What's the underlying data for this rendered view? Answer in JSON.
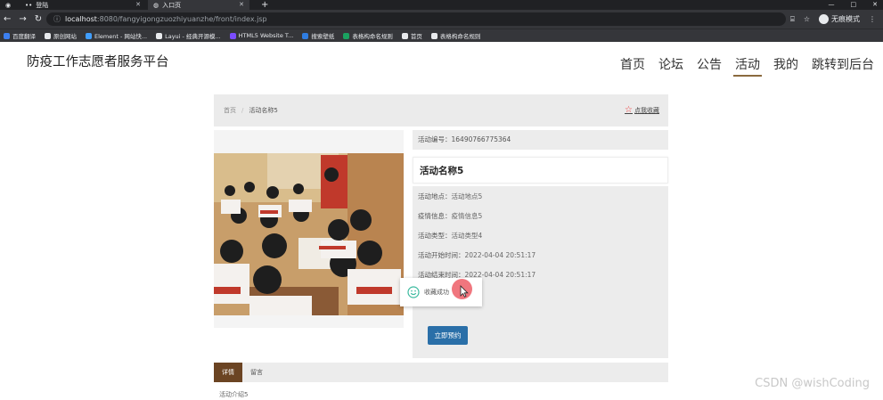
{
  "browser": {
    "tabs": [
      {
        "label": ""
      },
      {
        "label": "登陆"
      },
      {
        "label": "入口页"
      }
    ],
    "new_tab": "+",
    "window_controls": [
      "—",
      "□",
      "✕"
    ],
    "url_host": "localhost",
    "url_rest": ":8080/fangyigongzuozhiyuanzhe/front/index.jsp",
    "incognito_label": "无痕模式",
    "bookmarks": [
      {
        "label": "百度翻译",
        "color": "#3c7ff0"
      },
      {
        "label": "原创网站",
        "color": "#e8eaed"
      },
      {
        "label": "Element - 网站快...",
        "color": "#409eff"
      },
      {
        "label": "Layui - 经典开源模...",
        "color": "#e8eaed"
      },
      {
        "label": "HTML5 Website T...",
        "color": "#7c4dff"
      },
      {
        "label": "搜索壁纸",
        "color": "#2f7de1"
      },
      {
        "label": "表格构命名规则",
        "color": "#1aa260"
      },
      {
        "label": "首页",
        "color": "#e8eaed"
      },
      {
        "label": "表格构命名规则",
        "color": "#e8eaed"
      }
    ]
  },
  "site": {
    "title": "防疫工作志愿者服务平台",
    "nav": [
      "首页",
      "论坛",
      "公告",
      "活动",
      "我的",
      "跳转到后台"
    ],
    "active_nav": "活动"
  },
  "breadcrumb": {
    "home": "首页",
    "separator": "/",
    "current": "活动名称5",
    "favorite": "点我收藏"
  },
  "activity": {
    "id_label": "活动编号：",
    "id_value": "16490766775364",
    "name": "活动名称5",
    "fields": [
      {
        "label": "活动地点：",
        "value": "活动地点5"
      },
      {
        "label": "疫情信息：",
        "value": "疫情信息5"
      },
      {
        "label": "活动类型：",
        "value": "活动类型4"
      },
      {
        "label": "活动开始时间：",
        "value": "2022-04-04 20:51:17"
      },
      {
        "label": "活动结束时间：",
        "value": "2022-04-04 20:51:17"
      }
    ],
    "book_button": "立即预约"
  },
  "toast": {
    "message": "收藏成功",
    "icon": "smile-icon",
    "color": "#3cba9f"
  },
  "detail_tabs": [
    "详情",
    "留言"
  ],
  "detail_intro": "活动介绍5",
  "watermark": "CSDN @wishCoding",
  "colors": {
    "accent_brown": "#6b4423",
    "button_blue": "#2a6fa8",
    "nav_underline": "#8a6a3e",
    "favorite_star": "#e33333"
  }
}
